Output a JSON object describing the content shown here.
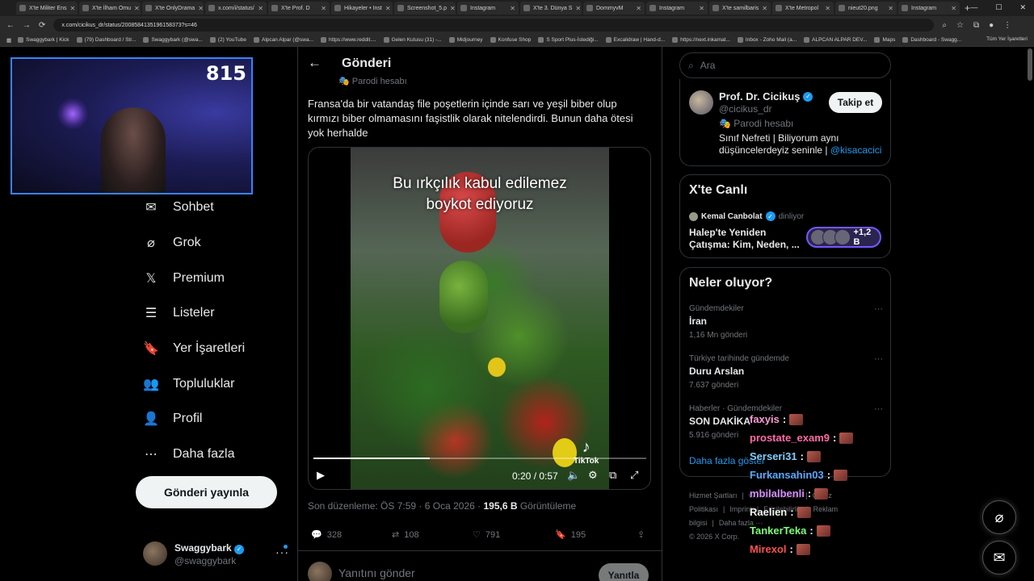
{
  "browser": {
    "tabs": [
      {
        "label": "X'te Militer Ens"
      },
      {
        "label": "X'te İlham Omu"
      },
      {
        "label": "X'te OnlyDrama"
      },
      {
        "label": "x.com/i/status/"
      },
      {
        "label": "X'te Prof. D"
      },
      {
        "label": "Hikayeler • Inst"
      },
      {
        "label": "Screenshot_5.p"
      },
      {
        "label": "Instagram"
      },
      {
        "label": "X'te 3. Dünya S"
      },
      {
        "label": "DommyvM"
      },
      {
        "label": "Instagram"
      },
      {
        "label": "X'te samilbaris"
      },
      {
        "label": "X'te Metropol"
      },
      {
        "label": "nieut20.png"
      },
      {
        "label": "Instagram"
      }
    ],
    "url": "x.com/cicikus_dr/status/2008584135196158373?s=46",
    "bookmarks": [
      "Swaggybark | Kick",
      "(79) Dashboard / Str...",
      "Swaggybark (@swa...",
      "(2) YouTube",
      "Alpcan Alpar (@swa...",
      "https://www.reddit....",
      "Gelen Kutusu (31) -...",
      "Midjourney",
      "Konfuse Shop",
      "S Sport Plus-İstediği...",
      "Excalidraw | Hand-d...",
      "https://next.inkamat...",
      "Inbox - Zoho Mail (a...",
      "ALPCAN ALPAR DEV...",
      "Maps",
      "Dashboard - Swagg..."
    ],
    "bookmarks_all": "Tüm Yer İşaretleri"
  },
  "webcam": {
    "counter": "815"
  },
  "nav": {
    "items": [
      {
        "label": "Sohbet",
        "icon": "mail-icon"
      },
      {
        "label": "Grok",
        "icon": "grok-icon"
      },
      {
        "label": "Premium",
        "icon": "x-logo-icon"
      },
      {
        "label": "Listeler",
        "icon": "list-icon"
      },
      {
        "label": "Yer İşaretleri",
        "icon": "bookmark-icon"
      },
      {
        "label": "Topluluklar",
        "icon": "people-icon"
      },
      {
        "label": "Profil",
        "icon": "person-icon"
      },
      {
        "label": "Daha fazla",
        "icon": "more-circle-icon"
      }
    ],
    "post_button": "Gönderi yayınla",
    "account": {
      "name": "Swaggybark",
      "handle": "@swaggybark"
    }
  },
  "post": {
    "header_title": "Gönderi",
    "parody_label": "Parodi hesabı",
    "text": "Fransa'da bir vatandaş file poşetlerin içinde sarı ve yeşil biber olup kırmızı biber olmamasını faşistlik olarak nitelendirdi. Bunun daha ötesi yok herhalde",
    "video": {
      "caption_line1": "Bu ırkçılık kabul edilemez",
      "caption_line2": "boykot ediyoruz",
      "watermark": "TikTok",
      "time": "0:20 / 0:57",
      "progress": 0.35
    },
    "meta": {
      "edited": "Son düzenleme: ÖS 7:59 · 6 Oca 2026 · ",
      "views_count": "195,6 B",
      "views_label": " Görüntüleme"
    },
    "stats": {
      "replies": "328",
      "reposts": "108",
      "likes": "791",
      "bookmarks": "195"
    },
    "reply_placeholder": "Yanıtını gönder",
    "reply_button": "Yanıtla"
  },
  "right": {
    "search_placeholder": "Ara",
    "profile": {
      "name": "Prof. Dr. Cicikuş",
      "handle": "@cicikus_dr",
      "parody": "Parodi hesabı",
      "bio": "Sınıf Nefreti | Biliyorum aynı düşüncelerdeyiz seninle | ",
      "bio_link": "@kisacacici",
      "follow": "Takip et"
    },
    "live": {
      "title": "X'te Canlı",
      "host": "Kemal Canbolat",
      "status": "dinliyor",
      "topic": "Halep'te Yeniden Çatışma: Kim, Neden, ...",
      "count": "+1,2 B"
    },
    "trends": {
      "title": "Neler oluyor?",
      "items": [
        {
          "category": "Gündemdekiler",
          "name": "İran",
          "count": "1,16 Mn gönderi"
        },
        {
          "category": "Türkiye tarihinde gündemde",
          "name": "Duru Arslan",
          "count": "7.637 gönderi"
        },
        {
          "category": "Haberler · Gündemdekiler",
          "name": "SON DAKİKA",
          "count": "5.916 gönderi"
        }
      ],
      "show_more": "Daha fazla göster"
    },
    "footer": {
      "links": [
        "Hizmet Şartları",
        "|",
        "Gizlilik Politikası",
        "|",
        "Çerez Politikası",
        "|",
        "Imprint",
        "|",
        "Erişilebilirlik",
        "|",
        "Reklam bilgisi",
        "|",
        "Daha fazla ···"
      ],
      "copyright": "© 2026 X Corp."
    }
  },
  "chat": [
    {
      "user": "faxyis",
      "color": "#ff9ad5"
    },
    {
      "user": "prostate_exam9",
      "color": "#ff6aa8"
    },
    {
      "user": "Serseri31",
      "color": "#7fd0ff"
    },
    {
      "user": "Furkansahin03",
      "color": "#5aa8ff"
    },
    {
      "user": "mbilalbenli",
      "color": "#d88cff"
    },
    {
      "user": "Raelien",
      "color": "#f3f3f3"
    },
    {
      "user": "TankerTeka",
      "color": "#7dff7a"
    },
    {
      "user": "Mirexol",
      "color": "#ff5050"
    }
  ],
  "colors": {
    "accent": "#1d9bf0",
    "live_ring": "#7856ff",
    "webcam_border": "#3b82f6"
  }
}
